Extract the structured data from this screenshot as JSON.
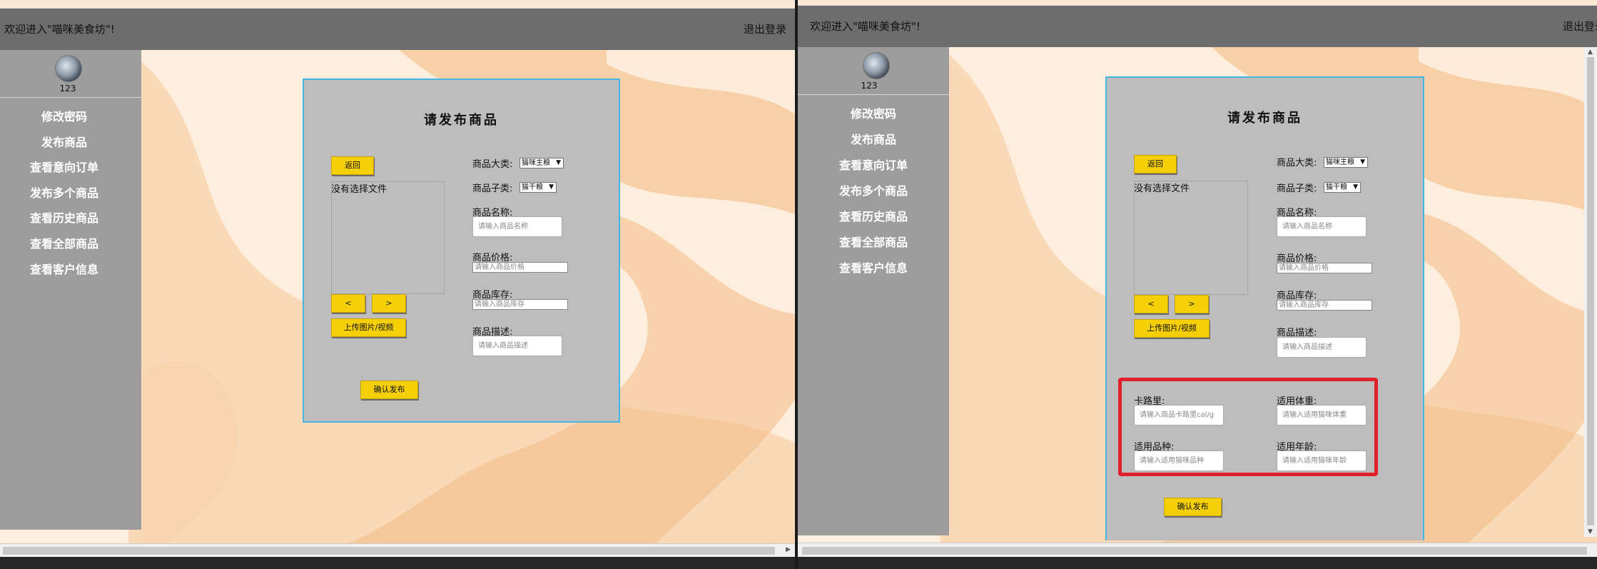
{
  "header": {
    "welcome": "欢迎进入\"喵咪美食坊\"!",
    "logout": "退出登录"
  },
  "user": {
    "name": "123"
  },
  "sidebar": {
    "items": [
      {
        "label": "修改密码"
      },
      {
        "label": "发布商品"
      },
      {
        "label": "查看意向订单"
      },
      {
        "label": "发布多个商品"
      },
      {
        "label": "查看历史商品"
      },
      {
        "label": "查看全部商品"
      },
      {
        "label": "查看客户信息"
      }
    ]
  },
  "form": {
    "title": "请发布商品",
    "back_label": "返回",
    "file_status": "没有选择文件",
    "prev_label": "<",
    "next_label": ">",
    "upload_label": "上传图片/视频",
    "submit_label": "确认发布",
    "category_label": "商品大类:",
    "category_value": "猫咪主粮",
    "subcategory_label": "商品子类:",
    "subcategory_value": "猫干粮",
    "name_label": "商品名称:",
    "name_placeholder": "请输入商品名称",
    "price_label": "商品价格:",
    "price_placeholder": "请输入商品价格",
    "stock_label": "商品库存:",
    "stock_placeholder": "请输入商品库存",
    "desc_label": "商品描述:",
    "desc_placeholder": "请输入商品描述"
  },
  "extra_fields": {
    "calorie_label": "卡路里:",
    "calorie_placeholder": "请输入商品卡路里cal/g",
    "weight_label": "适用体重:",
    "weight_placeholder": "请输入适用猫咪体重",
    "breed_label": "适用品种:",
    "breed_placeholder": "请输入适用猫咪品种",
    "age_label": "适用年龄:",
    "age_placeholder": "请输入适用猫咪年龄"
  },
  "colors": {
    "header": "#6d6d6d",
    "sidebar": "#9d9d9d",
    "card": "#bdbdbd",
    "card_border": "#48b4e2",
    "button": "#f5cf08",
    "highlight": "#e0202a",
    "background": "#f7e3cf"
  }
}
